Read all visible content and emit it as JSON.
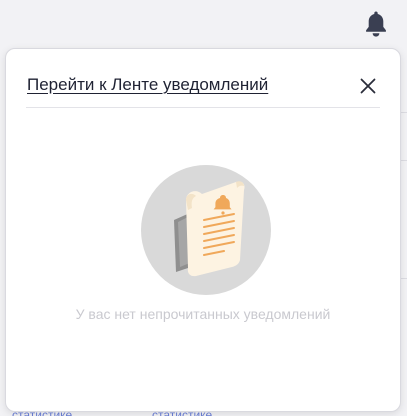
{
  "header": {
    "bell_icon": "bell-icon"
  },
  "popover": {
    "feed_link_label": "Перейти к Ленте уведомлений",
    "close_icon": "close-icon",
    "empty_illustration_icon": "document-bell-illustration",
    "empty_message": "У вас нет непрочитанных уведомлений"
  },
  "background": {
    "link_left": "статистике",
    "link_right": "статистике"
  },
  "colors": {
    "bell": "#3a3f52",
    "link_text": "#1f2233",
    "empty_text": "#c9c9cf",
    "illustration_circle": "#d9d9d9",
    "paper": "#fdf3e2",
    "accent": "#f0a85a"
  }
}
